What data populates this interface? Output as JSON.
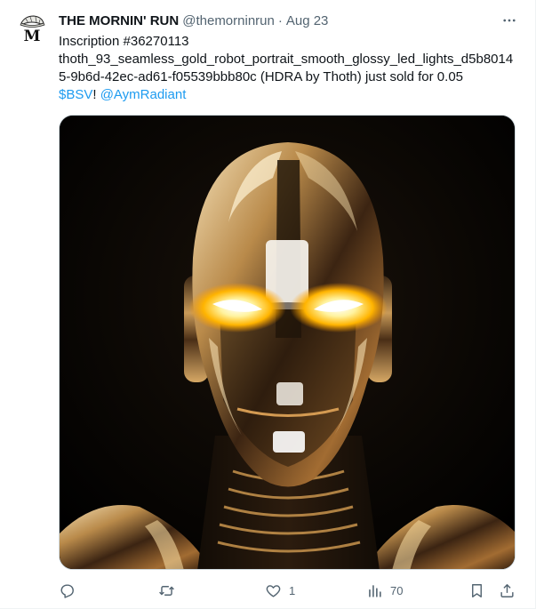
{
  "tweet": {
    "author_name": "THE MORNIN' RUN",
    "author_handle": "@themorninrun",
    "separator": "·",
    "date": "Aug 23",
    "avatar_letter": "M",
    "text": {
      "line1": "Inscription #36270113",
      "line2": "thoth_93_seamless_gold_robot_portrait_smooth_glossy_led_lights_d5b8014",
      "line3": "5-9b6d-42ec-ad61-f05539bbb80c (HDRA by Thoth) just sold for 0.05",
      "cashtag": "$BSV",
      "exclaim": "! ",
      "mention": "@AymRadiant"
    },
    "media": {
      "icon": "gold-robot-portrait-image"
    },
    "actions": {
      "reply": {
        "icon": "reply-icon",
        "count": ""
      },
      "retweet": {
        "icon": "retweet-icon",
        "count": ""
      },
      "like": {
        "icon": "heart-icon",
        "count": "1"
      },
      "views": {
        "icon": "views-icon",
        "count": "70"
      },
      "bookmark": {
        "icon": "bookmark-icon"
      },
      "share": {
        "icon": "share-icon"
      }
    }
  },
  "colors": {
    "link": "#1d9bf0",
    "secondary_text": "#536471",
    "primary_text": "#0f1419",
    "border": "#cfd9de"
  }
}
